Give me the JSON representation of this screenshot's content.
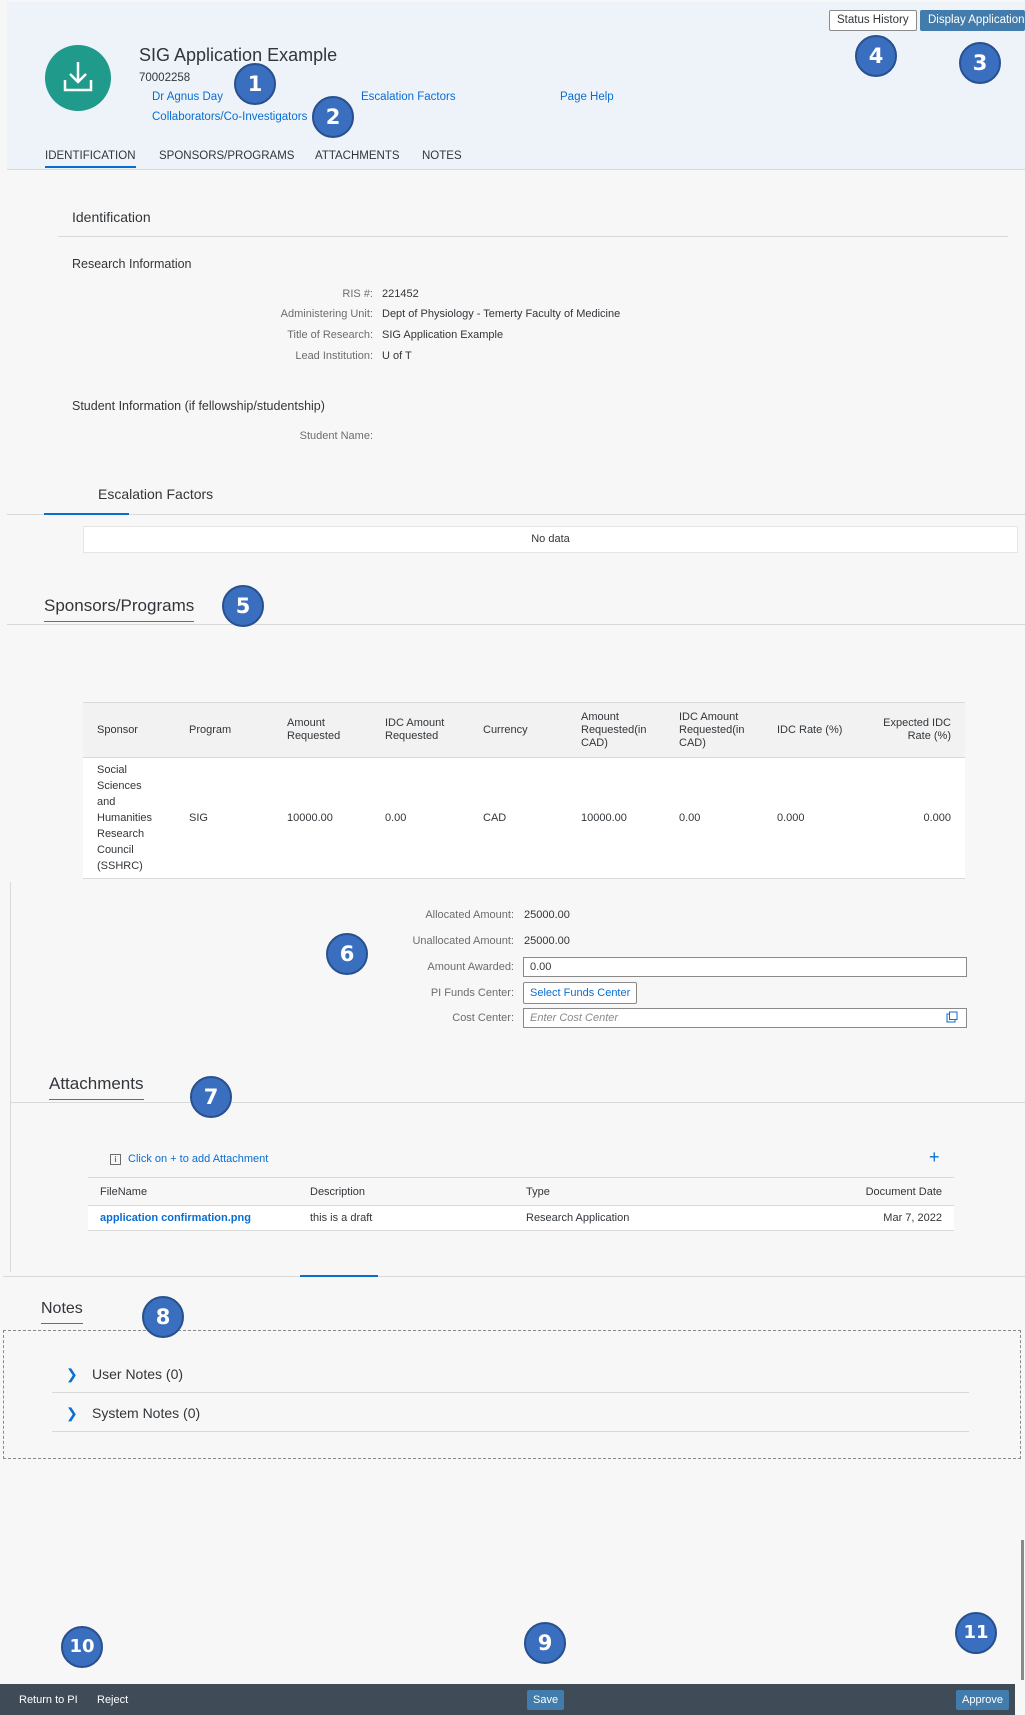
{
  "header": {
    "title": "SIG Application Example",
    "object_number": "70002258",
    "links": {
      "pi": "Dr Agnus Day",
      "escalation": "Escalation Factors",
      "help": "Page Help",
      "collaborators": "Collaborators/Co-Investigators"
    },
    "actions": {
      "status_history": "Status History",
      "display_application": "Display Application"
    },
    "avatar_icon": "download-tray-icon",
    "avatar_color": "#1f9a8b"
  },
  "tabs": [
    "IDENTIFICATION",
    "SPONSORS/PROGRAMS",
    "ATTACHMENTS",
    "NOTES"
  ],
  "identification": {
    "title": "Identification",
    "research_info": {
      "title": "Research Information",
      "fields": [
        {
          "label": "RIS #:",
          "value": "221452"
        },
        {
          "label": "Administering Unit:",
          "value": "Dept of Physiology - Temerty Faculty of Medicine"
        },
        {
          "label": "Title of Research:",
          "value": "SIG Application Example"
        },
        {
          "label": "Lead Institution:",
          "value": "U of T"
        }
      ]
    },
    "student_info": {
      "title": "Student Information (if fellowship/studentship)",
      "student_name_label": "Student Name:",
      "student_name_value": ""
    }
  },
  "escalation": {
    "title": "Escalation Factors",
    "empty_text": "No data"
  },
  "sponsors": {
    "title": "Sponsors/Programs",
    "columns": [
      "Sponsor",
      "Program",
      "Amount Requested",
      "IDC Amount Requested",
      "Currency",
      "Amount Requested(in CAD)",
      "IDC Amount Requested(in CAD)",
      "IDC Rate (%)",
      "Expected IDC Rate (%)"
    ],
    "rows": [
      [
        "Social Sciences and Humanities Research Council (SSHRC)",
        "SIG",
        "10000.00",
        "0.00",
        "CAD",
        "10000.00",
        "0.00",
        "0.000",
        "0.000"
      ]
    ],
    "allocated_label": "Allocated Amount:",
    "allocated_value": "25000.00",
    "unallocated_label": "Unallocated Amount:",
    "unallocated_value": "25000.00",
    "awarded_label": "Amount Awarded:",
    "awarded_value": "0.00",
    "funds_center_label": "PI Funds Center:",
    "funds_center_button": "Select Funds Center",
    "cost_center_label": "Cost Center:",
    "cost_center_placeholder": "Enter Cost Center"
  },
  "attachments": {
    "title": "Attachments",
    "hint": "Click on + to add Attachment",
    "columns": [
      "FileName",
      "Description",
      "Type",
      "Document Date"
    ],
    "rows": [
      [
        "application confirmation.png",
        "this is a draft",
        "Research Application",
        "Mar 7, 2022"
      ]
    ]
  },
  "notes": {
    "title": "Notes",
    "groups": [
      "User Notes (0)",
      "System Notes (0)"
    ]
  },
  "footer": {
    "return_to_pi": "Return to PI",
    "reject": "Reject",
    "save": "Save",
    "approve": "Approve"
  },
  "markers": [
    "1",
    "2",
    "3",
    "4",
    "5",
    "6",
    "7",
    "8",
    "9",
    "10",
    "11"
  ]
}
